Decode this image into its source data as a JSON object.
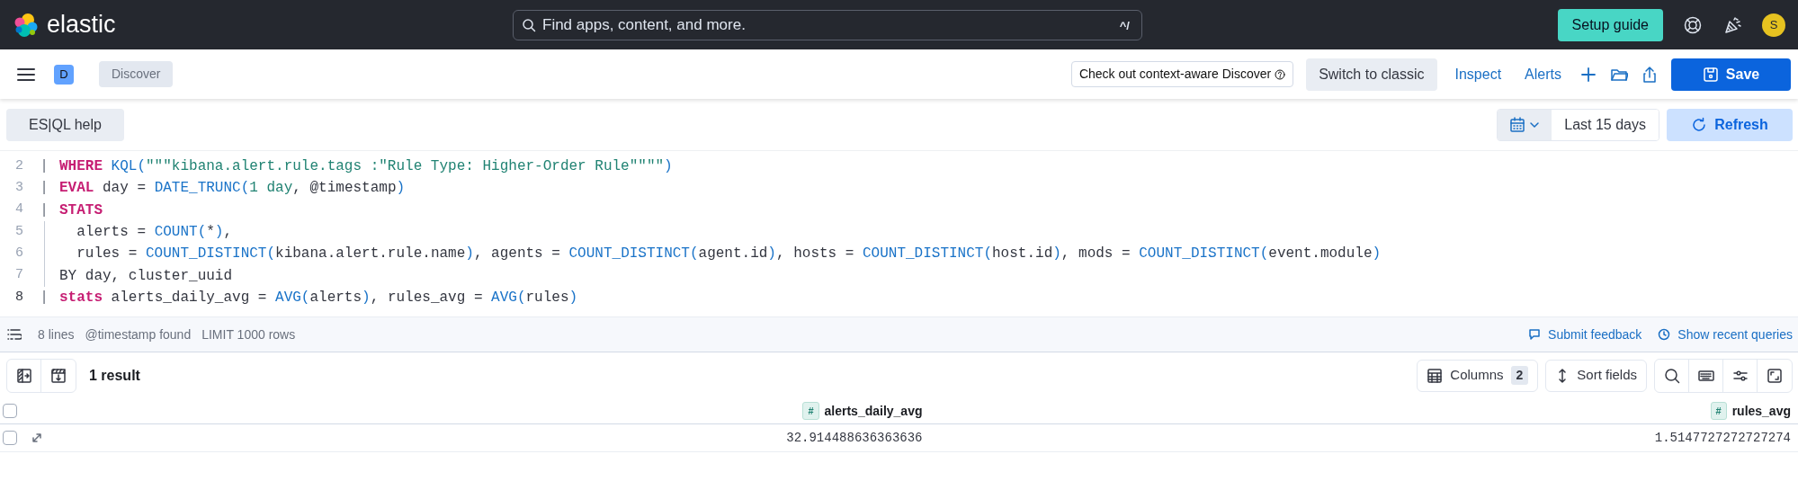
{
  "header": {
    "logo": "elastic",
    "search": {
      "placeholder": "Find apps, content, and more.",
      "shortcut": "^/"
    },
    "setup_button": "Setup guide",
    "avatar": "S"
  },
  "app_bar": {
    "space_badge": "D",
    "breadcrumb": "Discover",
    "callout": "Check out context-aware Discover",
    "switch_button": "Switch to classic",
    "links": [
      "Inspect",
      "Alerts"
    ],
    "save_button": "Save"
  },
  "query_bar": {
    "help_button": "ES|QL help",
    "date_range": "Last 15 days",
    "refresh_button": "Refresh"
  },
  "editor": {
    "lines": [
      {
        "number": "2",
        "current": false,
        "pipe": true,
        "guide": false,
        "tokens": [
          {
            "kind": "keyword",
            "t": "WHERE "
          },
          {
            "kind": "function",
            "t": "KQL("
          },
          {
            "kind": "string",
            "t": "\"\"\"kibana.alert.rule.tags :\"Rule Type: Higher-Order Rule\"\"\"\""
          },
          {
            "kind": "function",
            "t": ")"
          }
        ]
      },
      {
        "number": "3",
        "current": false,
        "pipe": true,
        "guide": false,
        "tokens": [
          {
            "kind": "keyword",
            "t": "EVAL"
          },
          {
            "kind": "plain",
            "t": " day = "
          },
          {
            "kind": "function",
            "t": "DATE_TRUNC("
          },
          {
            "kind": "string",
            "t": "1 day"
          },
          {
            "kind": "plain",
            "t": ", @timestamp"
          },
          {
            "kind": "function",
            "t": ")"
          }
        ]
      },
      {
        "number": "4",
        "current": false,
        "pipe": true,
        "guide": false,
        "tokens": [
          {
            "kind": "keyword",
            "t": "STATS"
          }
        ]
      },
      {
        "number": "5",
        "current": false,
        "pipe": false,
        "guide": true,
        "tokens": [
          {
            "kind": "plain",
            "t": "  alerts = "
          },
          {
            "kind": "function",
            "t": "COUNT("
          },
          {
            "kind": "plain",
            "t": "*"
          },
          {
            "kind": "function",
            "t": ")"
          },
          {
            "kind": "plain",
            "t": ","
          }
        ]
      },
      {
        "number": "6",
        "current": false,
        "pipe": false,
        "guide": true,
        "tokens": [
          {
            "kind": "plain",
            "t": "  rules = "
          },
          {
            "kind": "function",
            "t": "COUNT_DISTINCT("
          },
          {
            "kind": "plain",
            "t": "kibana.alert.rule.name"
          },
          {
            "kind": "function",
            "t": ")"
          },
          {
            "kind": "plain",
            "t": ", agents = "
          },
          {
            "kind": "function",
            "t": "COUNT_DISTINCT("
          },
          {
            "kind": "plain",
            "t": "agent.id"
          },
          {
            "kind": "function",
            "t": ")"
          },
          {
            "kind": "plain",
            "t": ", hosts = "
          },
          {
            "kind": "function",
            "t": "COUNT_DISTINCT("
          },
          {
            "kind": "plain",
            "t": "host.id"
          },
          {
            "kind": "function",
            "t": ")"
          },
          {
            "kind": "plain",
            "t": ", mods = "
          },
          {
            "kind": "function",
            "t": "COUNT_DISTINCT("
          },
          {
            "kind": "plain",
            "t": "event.module"
          },
          {
            "kind": "function",
            "t": ")"
          }
        ]
      },
      {
        "number": "7",
        "current": false,
        "pipe": false,
        "guide": true,
        "tokens": [
          {
            "kind": "plain",
            "t": "BY day, cluster_uuid"
          }
        ]
      },
      {
        "number": "8",
        "current": true,
        "pipe": true,
        "guide": false,
        "tokens": [
          {
            "kind": "keyword",
            "t": "stats"
          },
          {
            "kind": "plain",
            "t": " alerts_daily_avg = "
          },
          {
            "kind": "function",
            "t": "AVG("
          },
          {
            "kind": "plain",
            "t": "alerts"
          },
          {
            "kind": "function",
            "t": ")"
          },
          {
            "kind": "plain",
            "t": ", rules_avg = "
          },
          {
            "kind": "function",
            "t": "AVG("
          },
          {
            "kind": "plain",
            "t": "rules"
          },
          {
            "kind": "function",
            "t": ")"
          }
        ]
      }
    ],
    "pipe_char": "|"
  },
  "status_bar": {
    "items": [
      "8 lines",
      "@timestamp found",
      "LIMIT 1000 rows"
    ],
    "feedback_link": "Submit feedback",
    "recent_link": "Show recent queries"
  },
  "results": {
    "count": "1 result",
    "columns_button": "Columns",
    "columns_count": "2",
    "sort_button": "Sort fields",
    "table": {
      "header_checked": false,
      "columns": [
        {
          "type": "#",
          "name": "alerts_daily_avg"
        },
        {
          "type": "#",
          "name": "rules_avg"
        }
      ],
      "rows": [
        {
          "selected": false,
          "cells": [
            "32.914488636363636",
            "1.5147727272727274"
          ]
        }
      ]
    }
  }
}
